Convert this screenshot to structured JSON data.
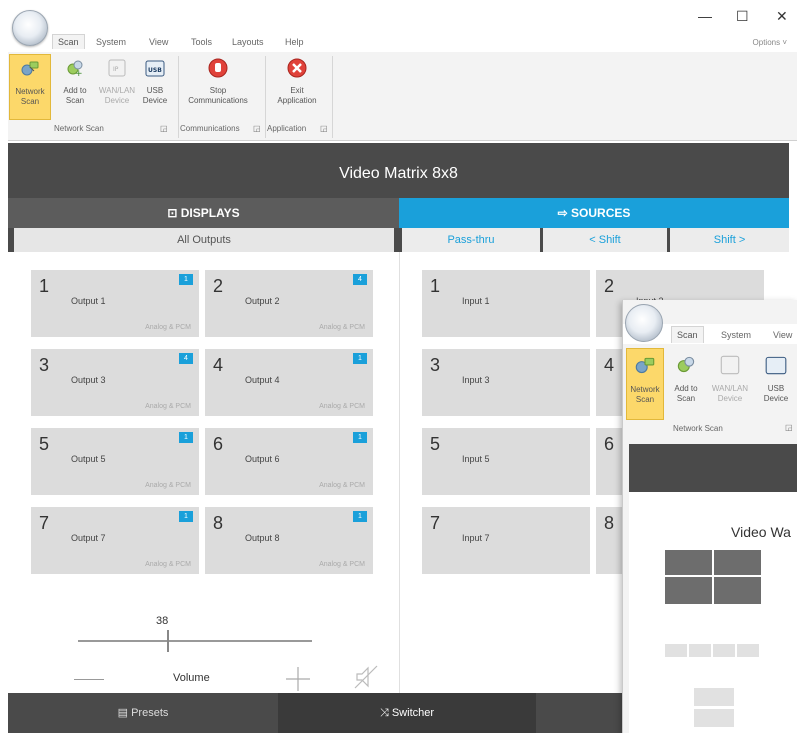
{
  "window": {
    "tabs": [
      "Scan",
      "System",
      "View",
      "Tools",
      "Layouts",
      "Help"
    ],
    "options": "Options",
    "controls": {
      "minimize": "—",
      "maximize": "☐",
      "close": "✕"
    }
  },
  "ribbon": {
    "network_scan": {
      "label1": "Network",
      "label2": "Scan"
    },
    "add_to_scan": {
      "label1": "Add to",
      "label2": "Scan"
    },
    "wan_lan": {
      "label1": "WAN/LAN",
      "label2": "Device"
    },
    "usb": {
      "label1": "USB",
      "label2": "Device",
      "icon_text": "USB"
    },
    "stop": {
      "label1": "Stop",
      "label2": "Communications"
    },
    "exit": {
      "label1": "Exit",
      "label2": "Application"
    },
    "groups": [
      "Network Scan",
      "Communications",
      "Application"
    ]
  },
  "app": {
    "title": "Video Matrix 8x8",
    "displays_tab": "DISPLAYS",
    "sources_tab": "SOURCES",
    "all_outputs": "All Outputs",
    "pass_thru": "Pass-thru",
    "shift_left": "< Shift",
    "shift_right": "Shift >",
    "outputs": [
      {
        "num": "1",
        "name": "Output 1",
        "format": "Analog & PCM",
        "badge": "1"
      },
      {
        "num": "2",
        "name": "Output 2",
        "format": "Analog & PCM",
        "badge": "4"
      },
      {
        "num": "3",
        "name": "Output 3",
        "format": "Analog & PCM",
        "badge": "4"
      },
      {
        "num": "4",
        "name": "Output 4",
        "format": "Analog & PCM",
        "badge": "1"
      },
      {
        "num": "5",
        "name": "Output 5",
        "format": "Analog & PCM",
        "badge": "1"
      },
      {
        "num": "6",
        "name": "Output 6",
        "format": "Analog & PCM",
        "badge": "1"
      },
      {
        "num": "7",
        "name": "Output 7",
        "format": "Analog & PCM",
        "badge": "1"
      },
      {
        "num": "8",
        "name": "Output 8",
        "format": "Analog & PCM",
        "badge": "1"
      }
    ],
    "inputs": [
      {
        "num": "1",
        "name": "Input 1"
      },
      {
        "num": "2",
        "name": "Input 2"
      },
      {
        "num": "3",
        "name": "Input 3"
      },
      {
        "num": "4",
        "name": ""
      },
      {
        "num": "5",
        "name": "Input 5"
      },
      {
        "num": "6",
        "name": ""
      },
      {
        "num": "7",
        "name": "Input 7"
      },
      {
        "num": "8",
        "name": ""
      }
    ],
    "volume_value": "38",
    "volume_level": 0.38,
    "volume_label": "Volume",
    "presets": "Presets",
    "switcher": "Switcher"
  },
  "overlay": {
    "tabs": [
      "Scan",
      "System",
      "View"
    ],
    "buttons": [
      {
        "label1": "Network",
        "label2": "Scan"
      },
      {
        "label1": "Add to",
        "label2": "Scan"
      },
      {
        "label1": "WAN/LAN",
        "label2": "Device"
      },
      {
        "label1": "USB",
        "label2": "Device"
      }
    ],
    "group": "Network Scan",
    "title": "Video Wa"
  }
}
